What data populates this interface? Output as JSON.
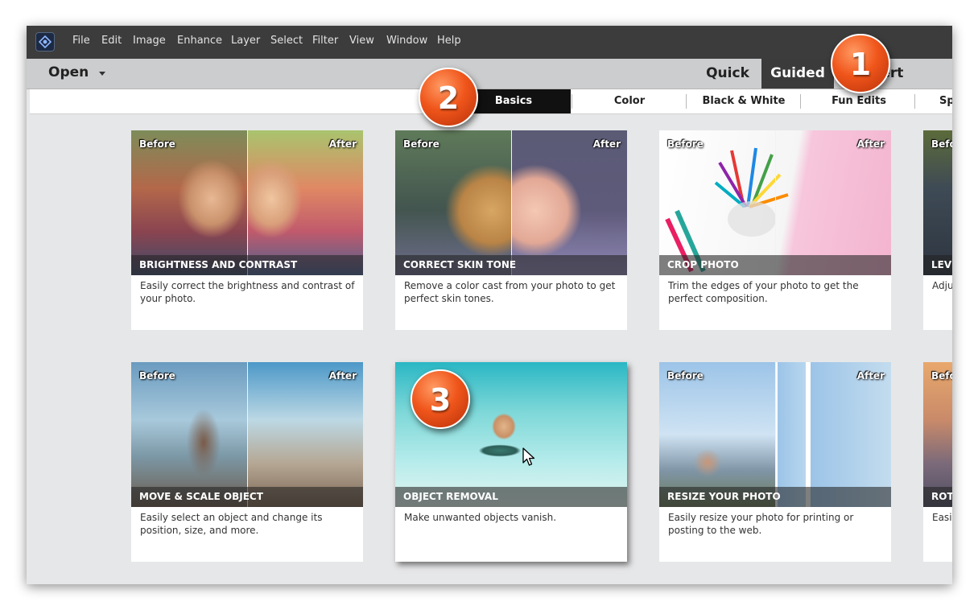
{
  "menu": [
    "File",
    "Edit",
    "Image",
    "Enhance",
    "Layer",
    "Select",
    "Filter",
    "View",
    "Window",
    "Help"
  ],
  "toolbar": {
    "open_label": "Open"
  },
  "modes": {
    "quick": "Quick",
    "guided": "Guided",
    "expert": "Expert"
  },
  "categories": [
    "Basics",
    "Color",
    "Black & White",
    "Fun Edits",
    "Special Edits"
  ],
  "labels": {
    "before": "Before",
    "after": "After"
  },
  "cards": [
    {
      "title": "BRIGHTNESS AND CONTRAST",
      "desc": "Easily correct the brightness and contrast of your photo."
    },
    {
      "title": "CORRECT SKIN TONE",
      "desc": "Remove a color cast from your photo to get perfect skin tones."
    },
    {
      "title": "CROP PHOTO",
      "desc": "Trim the edges of your photo to get the perfect composition."
    },
    {
      "title": "LEVELS",
      "desc": "Adjust the tonal range of your photo."
    },
    {
      "title": "MOVE & SCALE OBJECT",
      "desc": "Easily select an object and change its position, size, and more."
    },
    {
      "title": "OBJECT REMOVAL",
      "desc": "Make unwanted objects vanish."
    },
    {
      "title": "RESIZE YOUR PHOTO",
      "desc": "Easily resize your photo for printing or posting to the web."
    },
    {
      "title": "ROTATE AND STRAIGHTEN",
      "desc": "Easily rotate or straighten your photo."
    }
  ],
  "badges": [
    "1",
    "2",
    "3"
  ],
  "icons": {
    "app_logo": "photoshop-elements-logo",
    "open_caret": "caret-down-icon",
    "cursor": "mouse-pointer-icon"
  }
}
